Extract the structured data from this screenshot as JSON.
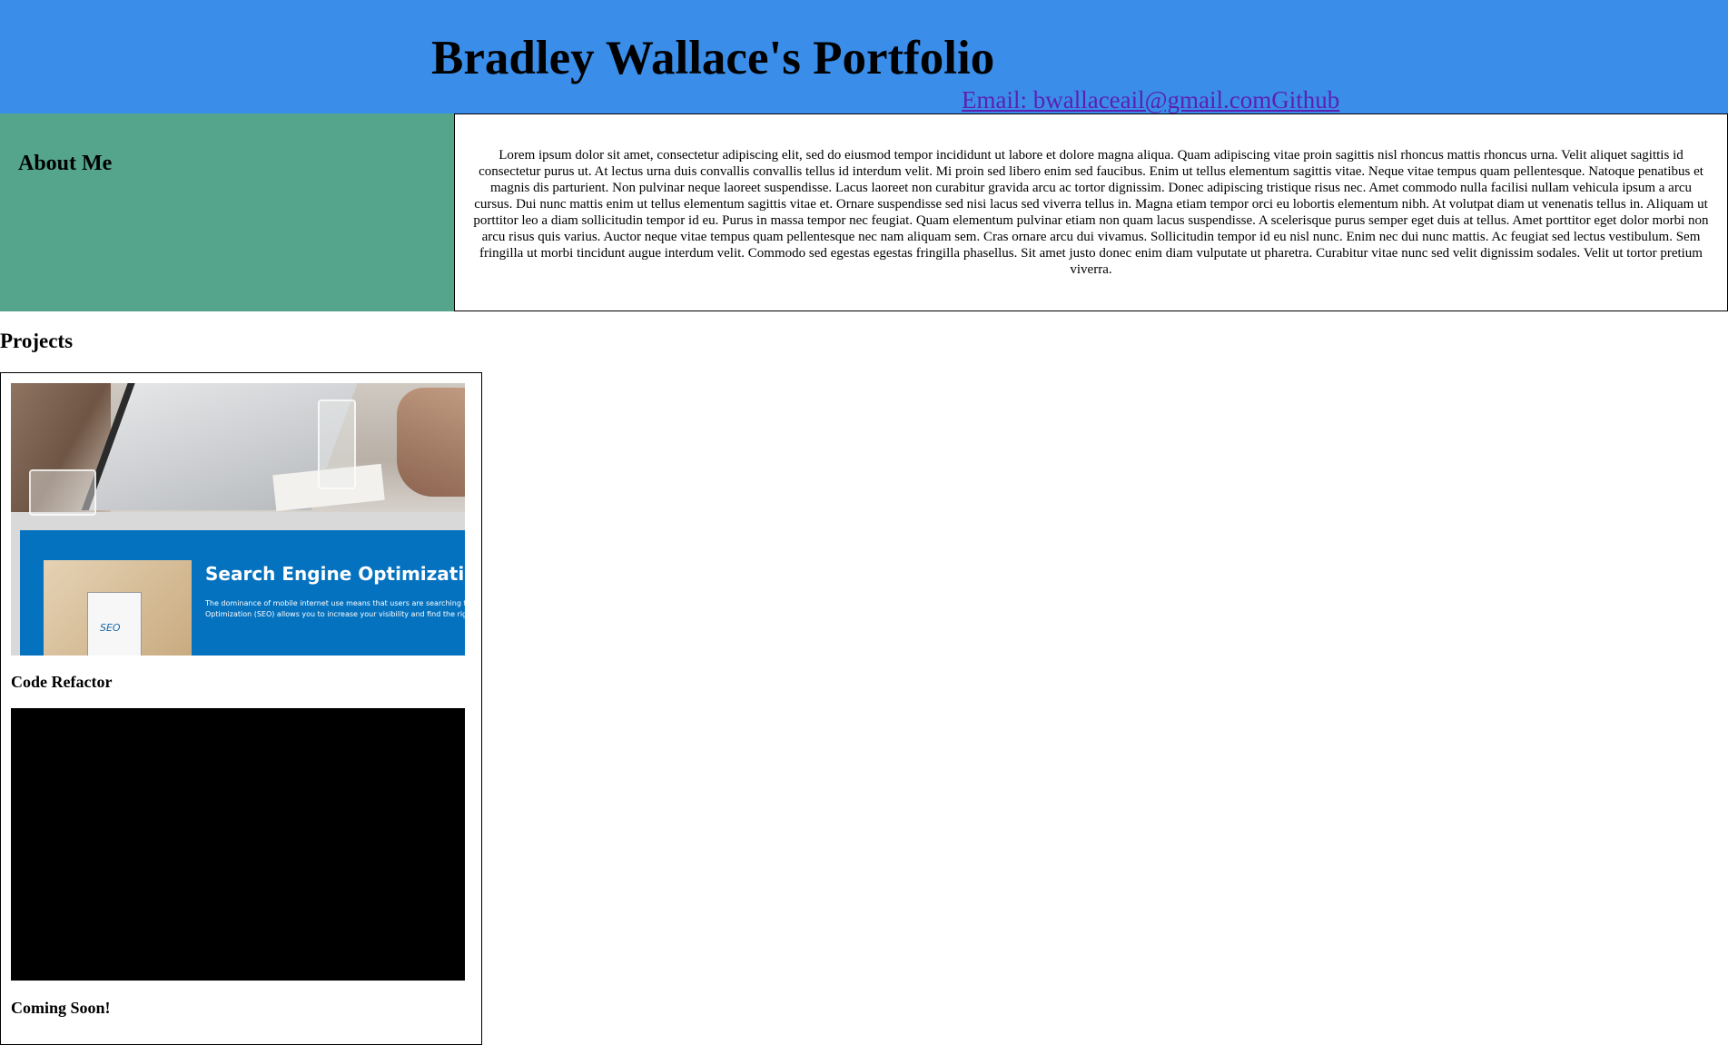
{
  "header": {
    "title": "Bradley Wallace's Portfolio",
    "email_link": "Email: bwallaceail@gmail.com",
    "github_link": "Github",
    "background_color": "#3a8ee9"
  },
  "about": {
    "heading": "About Me",
    "sidebar_color": "#55a58d",
    "body": "Lorem ipsum dolor sit amet, consectetur adipiscing elit, sed do eiusmod tempor incididunt ut labore et dolore magna aliqua. Quam adipiscing vitae proin sagittis nisl rhoncus mattis rhoncus urna. Velit aliquet sagittis id consectetur purus ut. At lectus urna duis convallis convallis tellus id interdum velit. Mi proin sed libero enim sed faucibus. Enim ut tellus elementum sagittis vitae. Neque vitae tempus quam pellentesque. Natoque penatibus et magnis dis parturient. Non pulvinar neque laoreet suspendisse. Lacus laoreet non curabitur gravida arcu ac tortor dignissim. Donec adipiscing tristique risus nec. Amet commodo nulla facilisi nullam vehicula ipsum a arcu cursus. Dui nunc mattis enim ut tellus elementum sagittis vitae et. Ornare suspendisse sed nisi lacus sed viverra tellus in. Magna etiam tempor orci eu lobortis elementum nibh. At volutpat diam ut venenatis tellus in. Aliquam ut porttitor leo a diam sollicitudin tempor id eu. Purus in massa tempor nec feugiat. Quam elementum pulvinar etiam non quam lacus suspendisse. A scelerisque purus semper eget duis at tellus. Amet porttitor eget dolor morbi non arcu risus quis varius. Auctor neque vitae tempus quam pellentesque nec nam aliquam sem. Cras ornare arcu dui vivamus. Sollicitudin tempor id eu nisl nunc. Enim nec dui nunc mattis. Ac feugiat sed lectus vestibulum. Sem fringilla ut morbi tincidunt augue interdum velit. Commodo sed egestas egestas fringilla phasellus. Sit amet justo donec enim diam vulputate ut pharetra. Curabitur vitae nunc sed velit dignissim sodales. Velit ut tortor pretium viverra."
  },
  "projects": {
    "heading": "Projects",
    "items": [
      {
        "caption": "Code Refactor",
        "banner_title": "Search Engine Optimization",
        "banner_text_line1": "The dominance of mobile internet use means that users are searching for the rig",
        "banner_text_line2": "Optimization (SEO) allows you to increase your visibility and find the right custo",
        "banner_badge": "SEO",
        "banner_color": "#0572bf"
      },
      {
        "caption": "Coming Soon!",
        "image_color": "#000000"
      }
    ]
  }
}
